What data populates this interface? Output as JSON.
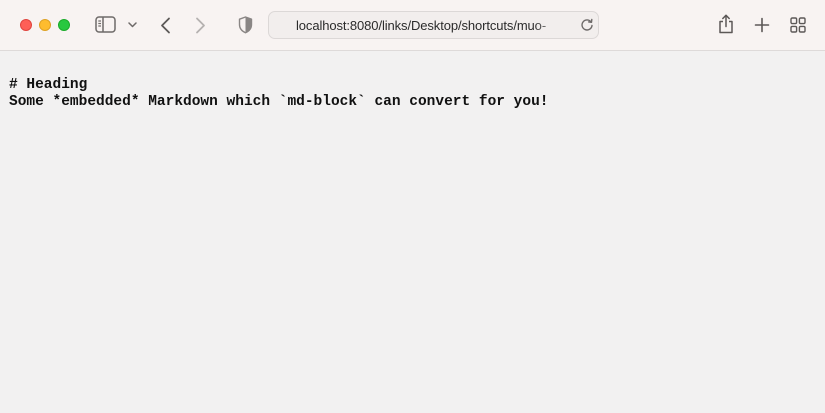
{
  "browser": {
    "url": "localhost:8080/links/Desktop/shortcuts/muo-",
    "icons": {
      "sidebar": "sidebar-icon",
      "sidebar_menu": "chevron-down-icon",
      "back": "chevron-left-icon",
      "forward": "chevron-right-icon",
      "privacy": "shield-icon",
      "reload": "reload-icon",
      "share": "share-icon",
      "new_tab": "plus-icon",
      "tab_overview": "grid-icon"
    },
    "colors": {
      "close": "#fe5f57",
      "minimize": "#febc2e",
      "maximize": "#28c840"
    }
  },
  "page": {
    "lines": [
      "# Heading",
      "Some *embedded* Markdown which `md-block` can convert for you!"
    ]
  }
}
